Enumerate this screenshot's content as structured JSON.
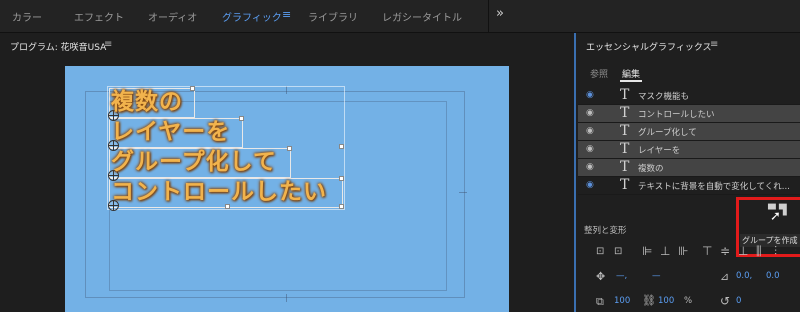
{
  "workspace_tabs": [
    "カラー",
    "エフェクト",
    "オーディオ",
    "グラフィック",
    "ライブラリ",
    "レガシータイトル"
  ],
  "active_workspace": "グラフィック",
  "workspace_more": "»",
  "program_monitor": {
    "title": "プログラム: 花咲音USA",
    "menu": "≡"
  },
  "canvas_text_lines": [
    "複数の",
    "レイヤーを",
    "グループ化して",
    "コントロールしたい"
  ],
  "essential_graphics": {
    "title": "エッセンシャルグラフィックス",
    "menu": "≡",
    "tabs": [
      "参照",
      "編集"
    ],
    "active_tab": "編集",
    "layers": [
      {
        "name": "マスク機能も",
        "visible": false,
        "selected": false
      },
      {
        "name": "コントロールしたい",
        "visible": true,
        "selected": true
      },
      {
        "name": "グループ化して",
        "visible": true,
        "selected": true
      },
      {
        "name": "レイヤーを",
        "visible": true,
        "selected": true
      },
      {
        "name": "複数の",
        "visible": true,
        "selected": true
      },
      {
        "name": "テキストに背景を自動で変化してくれ...",
        "visible": false,
        "selected": false
      }
    ],
    "create_group_tooltip": "グループを作成",
    "align_section_label": "整列と変形",
    "transform": {
      "position_x": "—,",
      "position_y": "—",
      "anchor_x": "0.0,",
      "anchor_y": "0.0",
      "scale": "100",
      "scale_h": "100",
      "percent": "%",
      "rotation": "0"
    }
  },
  "colors": {
    "accent": "#5b9ef3",
    "canvas": "#73b1e6",
    "text_fill": "#f1b34d",
    "highlight": "#e21b1b"
  }
}
